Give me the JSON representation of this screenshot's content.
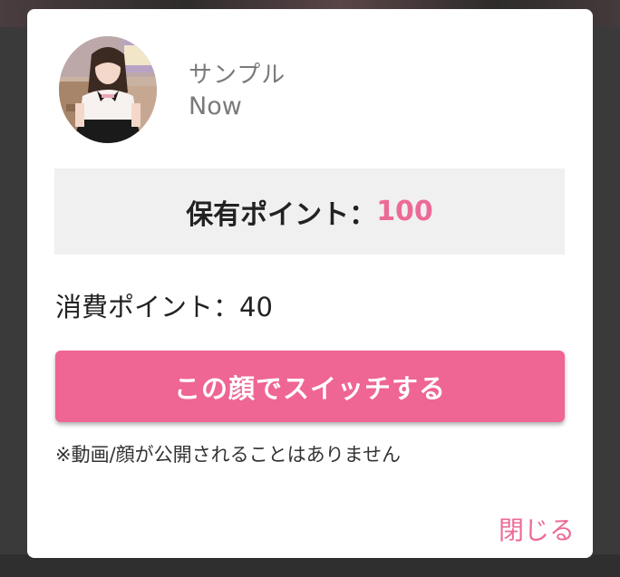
{
  "user": {
    "name": "サンプル",
    "status": "Now"
  },
  "points": {
    "owned_label": "保有ポイント：",
    "owned_value": "100",
    "cost_text": "消費ポイント：40"
  },
  "actions": {
    "switch_label": "この顔でスイッチする",
    "close_label": "閉じる"
  },
  "notice": "※動画/顔が公開されることはありません",
  "colors": {
    "accent": "#ef6593",
    "accent_text": "#ec6a98",
    "panel_bg": "#f0f0f0"
  }
}
